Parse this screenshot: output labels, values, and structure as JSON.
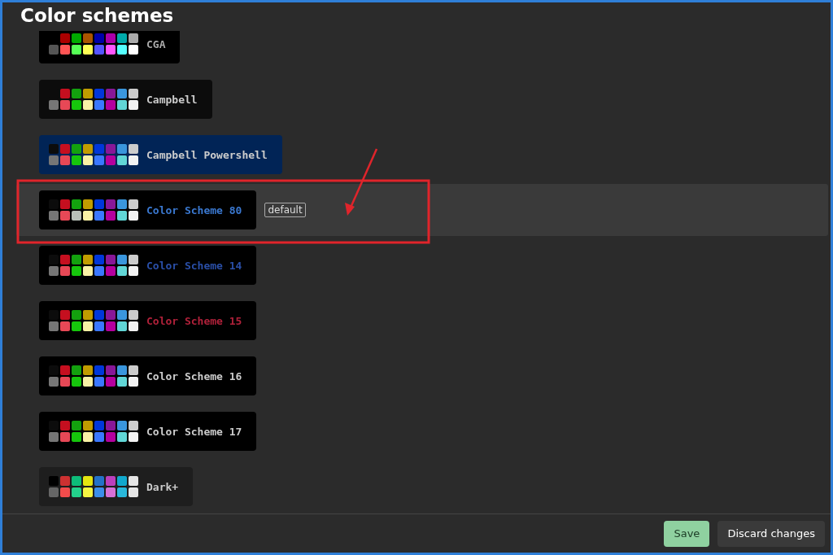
{
  "title": "Color schemes",
  "schemes": [
    {
      "name": "CGA",
      "selected": false,
      "color": "#aaaaaa",
      "card": {
        "color": "#000000"
      },
      "swatches": [
        {
          "color": "#000000"
        },
        {
          "color": "#aa0000"
        },
        {
          "color": "#00aa00"
        },
        {
          "color": "#aa5500"
        },
        {
          "color": "#0000aa"
        },
        {
          "color": "#aa00aa"
        },
        {
          "color": "#00aaaa"
        },
        {
          "color": "#aaaaaa"
        },
        {
          "color": "#555555"
        },
        {
          "color": "#ff5555"
        },
        {
          "color": "#55ff55"
        },
        {
          "color": "#ffff55"
        },
        {
          "color": "#5555ff"
        },
        {
          "color": "#ff55ff"
        },
        {
          "color": "#55ffff"
        },
        {
          "color": "#ffffff"
        }
      ]
    },
    {
      "name": "Campbell",
      "selected": false,
      "color": "#cccccc",
      "card": {
        "color": "#0c0c0c"
      },
      "swatches": [
        {
          "color": "#0c0c0c"
        },
        {
          "color": "#c50f1f"
        },
        {
          "color": "#13a10e"
        },
        {
          "color": "#c19c00"
        },
        {
          "color": "#0037da"
        },
        {
          "color": "#881798"
        },
        {
          "color": "#3a96dd"
        },
        {
          "color": "#cccccc"
        },
        {
          "color": "#767676"
        },
        {
          "color": "#e74856"
        },
        {
          "color": "#16c60c"
        },
        {
          "color": "#f9f1a5"
        },
        {
          "color": "#3b78ff"
        },
        {
          "color": "#b4009e"
        },
        {
          "color": "#61d6d6"
        },
        {
          "color": "#f2f2f2"
        }
      ]
    },
    {
      "name": "Campbell Powershell",
      "selected": false,
      "color": "#cccccc",
      "card": {
        "color": "#012456"
      },
      "swatches": [
        {
          "color": "#0c0c0c"
        },
        {
          "color": "#c50f1f"
        },
        {
          "color": "#13a10e"
        },
        {
          "color": "#c19c00"
        },
        {
          "color": "#0037da"
        },
        {
          "color": "#881798"
        },
        {
          "color": "#3a96dd"
        },
        {
          "color": "#cccccc"
        },
        {
          "color": "#767676"
        },
        {
          "color": "#e74856"
        },
        {
          "color": "#16c60c"
        },
        {
          "color": "#f9f1a5"
        },
        {
          "color": "#3b78ff"
        },
        {
          "color": "#b4009e"
        },
        {
          "color": "#61d6d6"
        },
        {
          "color": "#f2f2f2"
        }
      ]
    },
    {
      "name": "Color Scheme 80",
      "selected": true,
      "badge": "default",
      "color": "#3a78d0",
      "card": {
        "color": "#000000"
      },
      "swatches": [
        {
          "color": "#0c0c0c"
        },
        {
          "color": "#c50f1f"
        },
        {
          "color": "#13a10e"
        },
        {
          "color": "#c19c00"
        },
        {
          "color": "#0037da"
        },
        {
          "color": "#881798"
        },
        {
          "color": "#3a96dd"
        },
        {
          "color": "#cccccc"
        },
        {
          "color": "#767676"
        },
        {
          "color": "#e74856"
        },
        {
          "color": "#b8c0b8"
        },
        {
          "color": "#f9f1a5"
        },
        {
          "color": "#3b78ff"
        },
        {
          "color": "#b4009e"
        },
        {
          "color": "#61d6d6"
        },
        {
          "color": "#f2f2f2"
        }
      ]
    },
    {
      "name": "Color Scheme 14",
      "selected": false,
      "color": "#2a4fa8",
      "card": {
        "color": "#000000"
      },
      "swatches": [
        {
          "color": "#0c0c0c"
        },
        {
          "color": "#c50f1f"
        },
        {
          "color": "#13a10e"
        },
        {
          "color": "#c19c00"
        },
        {
          "color": "#0037da"
        },
        {
          "color": "#881798"
        },
        {
          "color": "#3a96dd"
        },
        {
          "color": "#cccccc"
        },
        {
          "color": "#767676"
        },
        {
          "color": "#e74856"
        },
        {
          "color": "#16c60c"
        },
        {
          "color": "#f9f1a5"
        },
        {
          "color": "#3b78ff"
        },
        {
          "color": "#b4009e"
        },
        {
          "color": "#61d6d6"
        },
        {
          "color": "#f2f2f2"
        }
      ]
    },
    {
      "name": "Color Scheme 15",
      "selected": false,
      "color": "#b0213a",
      "card": {
        "color": "#000000"
      },
      "swatches": [
        {
          "color": "#0c0c0c"
        },
        {
          "color": "#c50f1f"
        },
        {
          "color": "#13a10e"
        },
        {
          "color": "#c19c00"
        },
        {
          "color": "#0037da"
        },
        {
          "color": "#881798"
        },
        {
          "color": "#3a96dd"
        },
        {
          "color": "#cccccc"
        },
        {
          "color": "#767676"
        },
        {
          "color": "#e74856"
        },
        {
          "color": "#16c60c"
        },
        {
          "color": "#f9f1a5"
        },
        {
          "color": "#3b78ff"
        },
        {
          "color": "#b4009e"
        },
        {
          "color": "#61d6d6"
        },
        {
          "color": "#f2f2f2"
        }
      ]
    },
    {
      "name": "Color Scheme 16",
      "selected": false,
      "color": "#cccccc",
      "card": {
        "color": "#000000"
      },
      "swatches": [
        {
          "color": "#0c0c0c"
        },
        {
          "color": "#c50f1f"
        },
        {
          "color": "#13a10e"
        },
        {
          "color": "#c19c00"
        },
        {
          "color": "#0037da"
        },
        {
          "color": "#881798"
        },
        {
          "color": "#3a96dd"
        },
        {
          "color": "#cccccc"
        },
        {
          "color": "#767676"
        },
        {
          "color": "#e74856"
        },
        {
          "color": "#16c60c"
        },
        {
          "color": "#f9f1a5"
        },
        {
          "color": "#3b78ff"
        },
        {
          "color": "#b4009e"
        },
        {
          "color": "#61d6d6"
        },
        {
          "color": "#f2f2f2"
        }
      ]
    },
    {
      "name": "Color Scheme 17",
      "selected": false,
      "color": "#cccccc",
      "card": {
        "color": "#000000"
      },
      "swatches": [
        {
          "color": "#0c0c0c"
        },
        {
          "color": "#c50f1f"
        },
        {
          "color": "#13a10e"
        },
        {
          "color": "#c19c00"
        },
        {
          "color": "#0037da"
        },
        {
          "color": "#881798"
        },
        {
          "color": "#3a96dd"
        },
        {
          "color": "#cccccc"
        },
        {
          "color": "#767676"
        },
        {
          "color": "#e74856"
        },
        {
          "color": "#16c60c"
        },
        {
          "color": "#f9f1a5"
        },
        {
          "color": "#3b78ff"
        },
        {
          "color": "#b4009e"
        },
        {
          "color": "#61d6d6"
        },
        {
          "color": "#f2f2f2"
        }
      ]
    },
    {
      "name": "Dark+",
      "selected": false,
      "color": "#cccccc",
      "card": {
        "color": "#1e1e1e"
      },
      "swatches": [
        {
          "color": "#000000"
        },
        {
          "color": "#cd3131"
        },
        {
          "color": "#0dbc79"
        },
        {
          "color": "#e5e510"
        },
        {
          "color": "#2472c8"
        },
        {
          "color": "#bc3fbc"
        },
        {
          "color": "#11a8cd"
        },
        {
          "color": "#e5e5e5"
        },
        {
          "color": "#666666"
        },
        {
          "color": "#f14c4c"
        },
        {
          "color": "#23d18b"
        },
        {
          "color": "#f5f543"
        },
        {
          "color": "#3b8eea"
        },
        {
          "color": "#d670d6"
        },
        {
          "color": "#29b8db"
        },
        {
          "color": "#e5e5e5"
        }
      ]
    }
  ],
  "buttons": [
    {
      "label": "Save",
      "kind": "primary"
    },
    {
      "label": "Discard changes",
      "kind": "secondary"
    }
  ]
}
